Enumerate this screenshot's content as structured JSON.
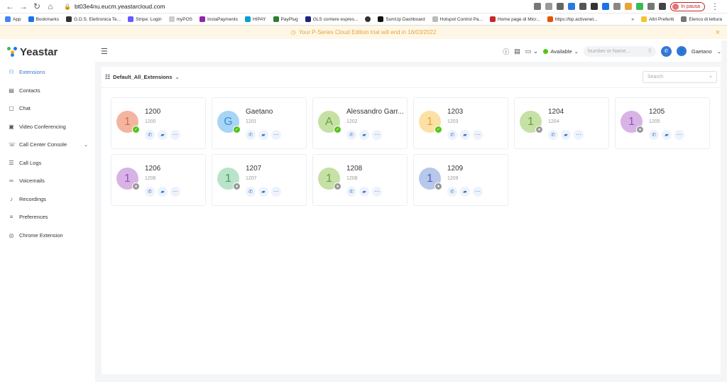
{
  "browser": {
    "url": "bt03e4nu.eucm.yeastarcloud.com",
    "pause_label": "In pausa",
    "bookmarks": [
      "App",
      "Bookmarks",
      "G.D.S. Elettronica Te...",
      "Stripe: Login",
      "myPOS",
      "InstaPayments",
      "HIPAY",
      "PayPlug",
      "GLS corriere espres...",
      "",
      "SumUp Dashboard",
      "Hotspot Control Pa...",
      "Home page di Micr...",
      "https://bp.activenet..."
    ],
    "bookmarks_right": [
      "»",
      "Altri Preferiti",
      "Elenco di lettura"
    ]
  },
  "trial_banner": "Your P-Series Cloud Edition trial will end in 16/03/2022",
  "logo": "Yeastar",
  "menu": [
    {
      "label": "Extensions",
      "icon": "users-icon",
      "active": true
    },
    {
      "label": "Contacts",
      "icon": "contacts-icon"
    },
    {
      "label": "Chat",
      "icon": "chat-icon"
    },
    {
      "label": "Video Conferencing",
      "icon": "video-icon"
    },
    {
      "label": "Call Center Console",
      "icon": "headset-icon",
      "chevron": true
    },
    {
      "label": "Call Logs",
      "icon": "call-log-icon"
    },
    {
      "label": "Voicemails",
      "icon": "voicemail-icon"
    },
    {
      "label": "Recordings",
      "icon": "mic-icon"
    },
    {
      "label": "Preferences",
      "icon": "settings-icon"
    },
    {
      "label": "Chrome Extension",
      "icon": "chrome-icon"
    }
  ],
  "topbar": {
    "status": "Available",
    "dial_placeholder": "Number or Name...",
    "user": "Gaetano"
  },
  "main": {
    "group": "Default_All_Extensions",
    "search_placeholder": "Search"
  },
  "extensions": [
    {
      "name": "1200",
      "ext": "1200",
      "initial": "1",
      "bg": "#f3b5a0",
      "fg": "#e06a3a",
      "status": "online"
    },
    {
      "name": "Gaetano",
      "ext": "1201",
      "initial": "G",
      "bg": "#a8d4f5",
      "fg": "#3b8fd6",
      "status": "online"
    },
    {
      "name": "Alessandro Garr...",
      "ext": "1202",
      "initial": "A",
      "bg": "#c5e1a5",
      "fg": "#6a9e3a",
      "status": "online"
    },
    {
      "name": "1203",
      "ext": "1203",
      "initial": "1",
      "bg": "#fde0a6",
      "fg": "#e8a33b",
      "status": "online"
    },
    {
      "name": "1204",
      "ext": "1204",
      "initial": "1",
      "bg": "#c5e1a5",
      "fg": "#6a9e3a",
      "status": "offline"
    },
    {
      "name": "1205",
      "ext": "1205",
      "initial": "1",
      "bg": "#d8b3e6",
      "fg": "#9c4fbf",
      "status": "offline"
    },
    {
      "name": "1206",
      "ext": "1206",
      "initial": "1",
      "bg": "#d8b3e6",
      "fg": "#9c4fbf",
      "status": "offline"
    },
    {
      "name": "1207",
      "ext": "1207",
      "initial": "1",
      "bg": "#b9e4c9",
      "fg": "#3f9e62",
      "status": "offline"
    },
    {
      "name": "1208",
      "ext": "1208",
      "initial": "1",
      "bg": "#c5e1a5",
      "fg": "#6a9e3a",
      "status": "offline"
    },
    {
      "name": "1209",
      "ext": "1209",
      "initial": "1",
      "bg": "#b8c7ec",
      "fg": "#4a64b8",
      "status": "offline"
    }
  ],
  "colors": {
    "accent": "#3478d6",
    "online": "#52c41a",
    "trial": "#e6a23c"
  }
}
